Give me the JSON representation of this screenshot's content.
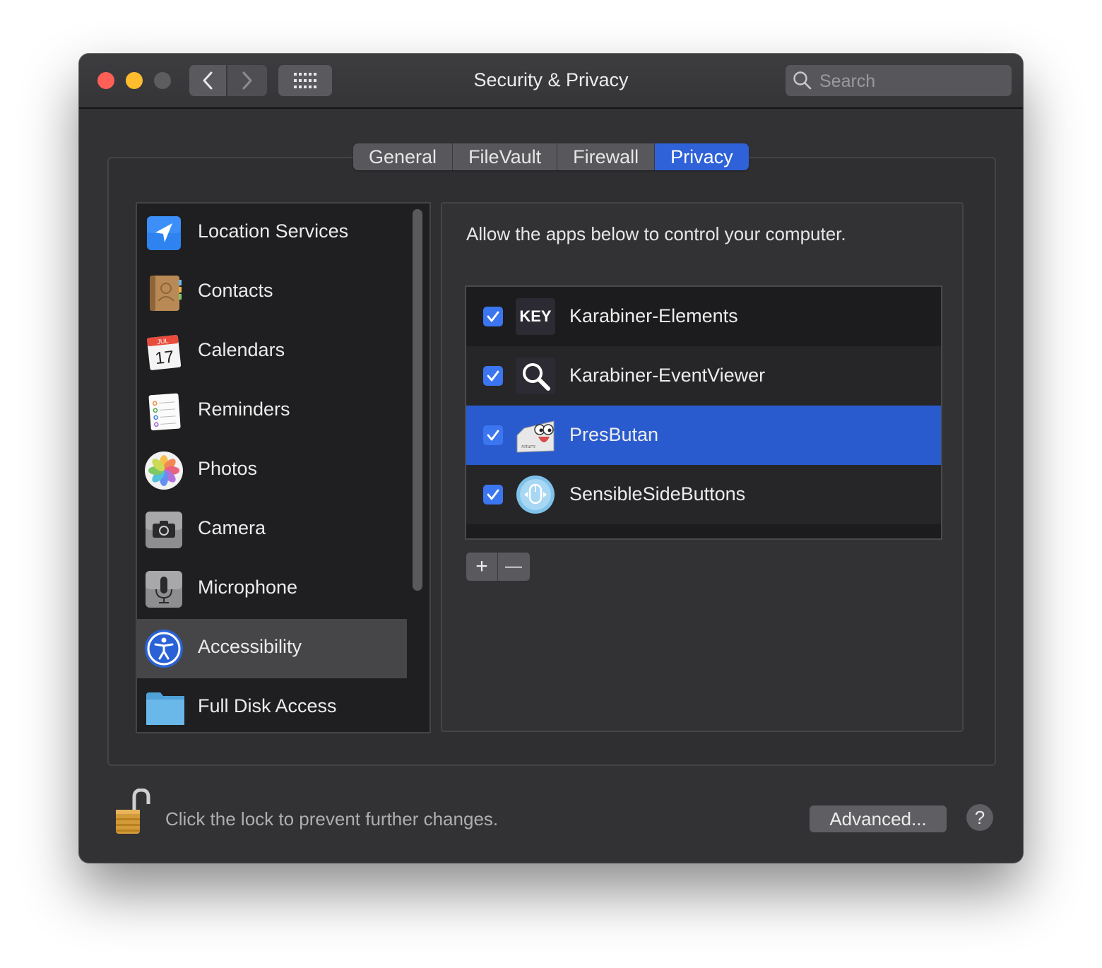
{
  "window": {
    "title": "Security & Privacy",
    "search_placeholder": "Search"
  },
  "tabs": [
    {
      "label": "General",
      "active": false
    },
    {
      "label": "FileVault",
      "active": false
    },
    {
      "label": "Firewall",
      "active": false
    },
    {
      "label": "Privacy",
      "active": true
    }
  ],
  "sidebar": {
    "items": [
      {
        "label": "Location Services",
        "icon": "location-arrow-icon"
      },
      {
        "label": "Contacts",
        "icon": "contacts-book-icon"
      },
      {
        "label": "Calendars",
        "icon": "calendar-icon",
        "icon_month": "JUL",
        "icon_day": "17"
      },
      {
        "label": "Reminders",
        "icon": "reminders-list-icon"
      },
      {
        "label": "Photos",
        "icon": "photos-flower-icon"
      },
      {
        "label": "Camera",
        "icon": "camera-icon"
      },
      {
        "label": "Microphone",
        "icon": "microphone-icon"
      },
      {
        "label": "Accessibility",
        "icon": "accessibility-icon",
        "selected": true
      },
      {
        "label": "Full Disk Access",
        "icon": "folder-icon"
      }
    ]
  },
  "privacy": {
    "instruction": "Allow the apps below to control your computer.",
    "apps": [
      {
        "name": "Karabiner-Elements",
        "checked": true,
        "icon": "key-icon",
        "icon_text": "KEY"
      },
      {
        "name": "Karabiner-EventViewer",
        "checked": true,
        "icon": "magnifier-icon"
      },
      {
        "name": "PresButan",
        "checked": true,
        "icon": "return-key-eyes-icon",
        "icon_text": "return",
        "selected": true
      },
      {
        "name": "SensibleSideButtons",
        "checked": true,
        "icon": "mouse-icon"
      }
    ],
    "add_symbol": "+",
    "remove_symbol": "—"
  },
  "footer": {
    "lock_message": "Click the lock to prevent further changes.",
    "advanced_label": "Advanced...",
    "help_label": "?"
  },
  "colors": {
    "accent": "#2f62d8",
    "selected_row": "#2a5bce",
    "checkbox": "#3b76f0",
    "window_bg": "#323235"
  }
}
